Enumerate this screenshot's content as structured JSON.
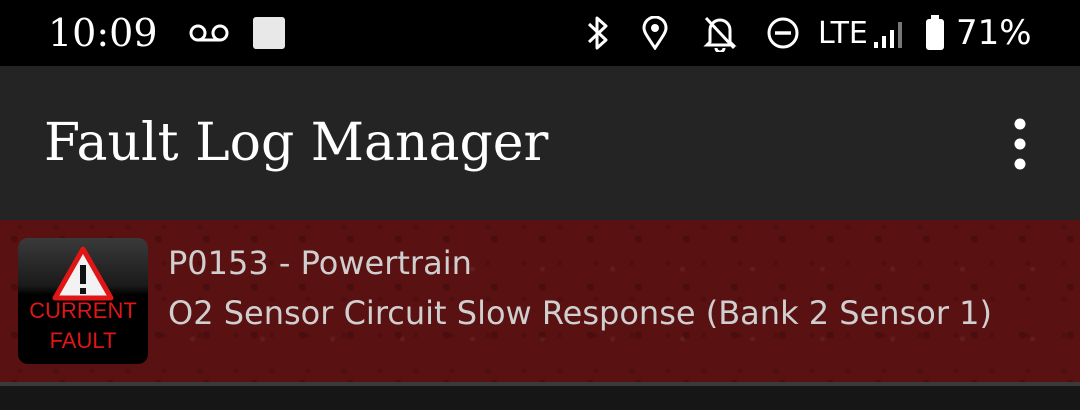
{
  "status_bar": {
    "time": "10:09",
    "network": "LTE",
    "battery_percent": "71%",
    "icons": [
      "voicemail-icon",
      "notification-square-icon",
      "bluetooth-icon",
      "location-icon",
      "notifications-off-icon",
      "do-not-disturb-icon",
      "signal-icon",
      "battery-icon"
    ]
  },
  "app_bar": {
    "title": "Fault Log Manager",
    "menu_icon": "more-vert-icon"
  },
  "faults": [
    {
      "code_line": "P0153 - Powertrain",
      "description": "O2 Sensor Circuit Slow Response (Bank 2 Sensor 1)",
      "badge_line1": "CURRENT",
      "badge_line2": "FAULT",
      "badge_icon": "warning-triangle-icon"
    }
  ],
  "colors": {
    "fault_row_bg": "#5a1111",
    "app_bar_bg": "#242424",
    "status_bar_bg": "#000000",
    "badge_text": "#e01616"
  }
}
